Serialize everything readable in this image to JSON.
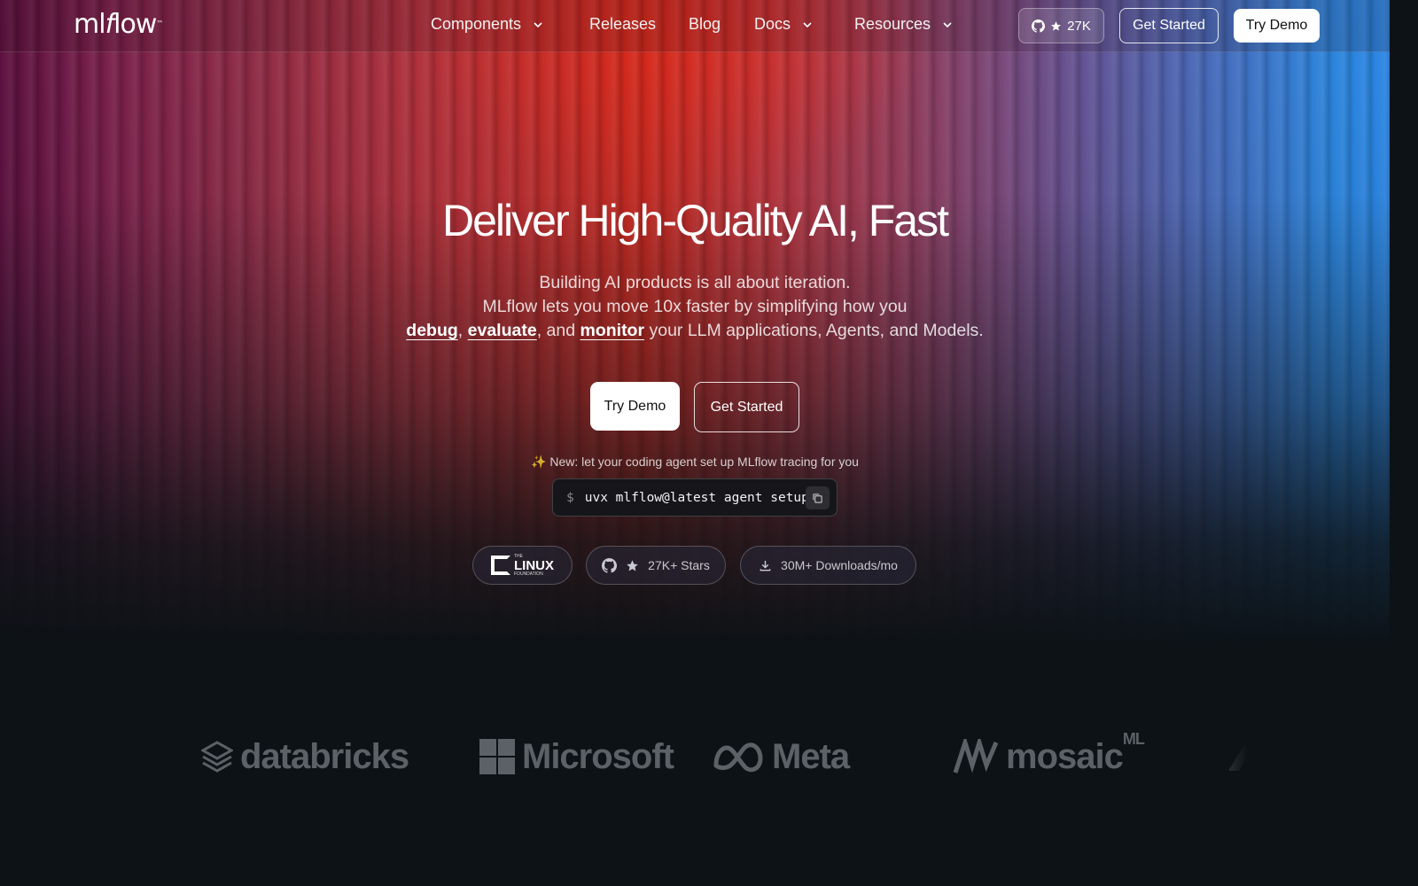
{
  "nav": {
    "logo": "mlflow",
    "items": [
      {
        "label": "Components",
        "dropdown": true
      },
      {
        "label": "Releases",
        "dropdown": false
      },
      {
        "label": "Blog",
        "dropdown": false
      },
      {
        "label": "Docs",
        "dropdown": true
      },
      {
        "label": "Resources",
        "dropdown": true
      }
    ],
    "github_stars": "27K",
    "get_started": "Get Started",
    "try_demo": "Try Demo"
  },
  "hero": {
    "headline": "Deliver High-Quality AI, Fast",
    "line1": "Building AI products is all about iteration.",
    "line2": "MLflow lets you move 10x faster by simplifying how you",
    "line3": {
      "link1": "debug",
      "sep1": ",",
      "link2": "evaluate",
      "sep2": ", and",
      "link3": "monitor",
      "rest": "your LLM applications, Agents, and Models."
    },
    "try_demo": "Try Demo",
    "get_started": "Get Started",
    "new_note_icon": "✨",
    "new_note": "New: let your coding agent set up MLflow tracing for you",
    "command_prompt": "$",
    "command": "uvx mlflow@latest agent setup"
  },
  "badges": {
    "linux_small": "THE",
    "linux_big": "LINUX",
    "linux_foundation": "FOUNDATION",
    "stars": "27K+ Stars",
    "downloads": "30M+ Downloads/mo"
  },
  "partners": [
    "databricks",
    "Microsoft",
    "Meta",
    "mosaic"
  ],
  "partner_mosaic_sup": "ML",
  "colors": {
    "background": "#0c1216",
    "partner_logo": "#5b6166",
    "hero_red": "#c8281f",
    "hero_blue": "#2a86e6"
  }
}
